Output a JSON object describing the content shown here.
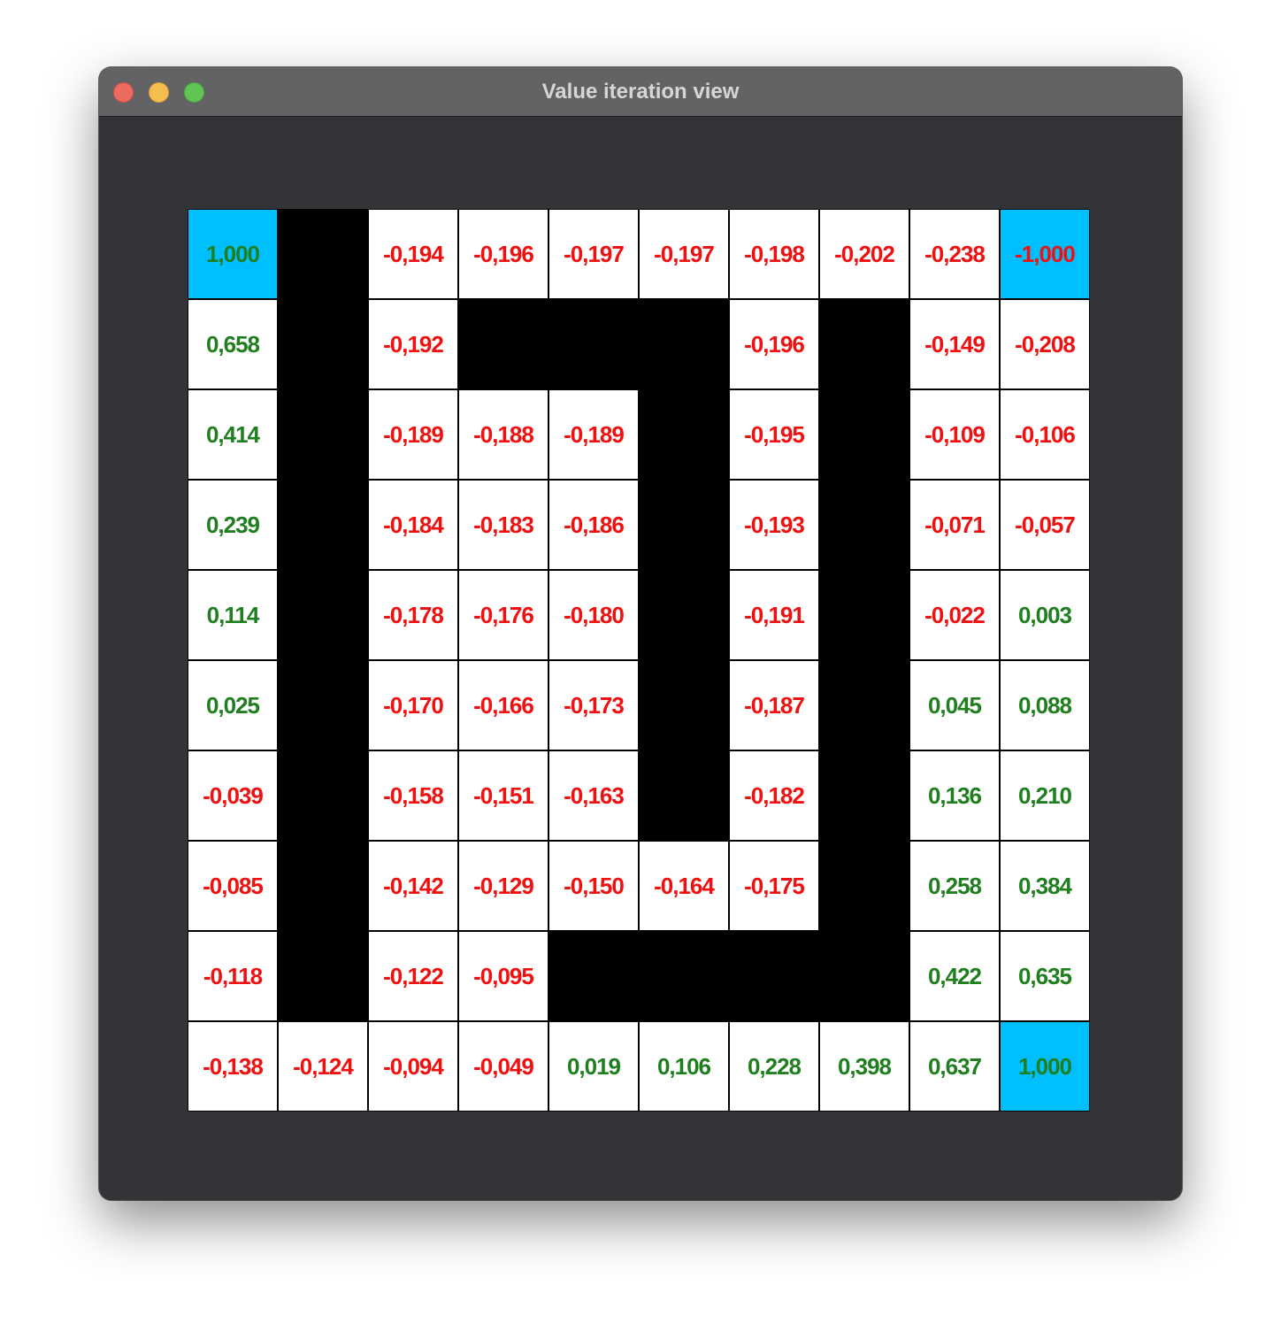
{
  "window": {
    "title": "Value iteration view"
  },
  "colors": {
    "open": "#ffffff",
    "wall": "#000000",
    "terminal": "#00bfff",
    "positive_text": "#1f7f1f",
    "negative_text": "#f01010",
    "window_bg": "#333438",
    "titlebar_bg": "#636265"
  },
  "grid": {
    "cols": 10,
    "rows": [
      [
        {
          "t": "terminal",
          "v": "1,000"
        },
        {
          "t": "wall"
        },
        {
          "t": "open",
          "v": "-0,194"
        },
        {
          "t": "open",
          "v": "-0,196"
        },
        {
          "t": "open",
          "v": "-0,197"
        },
        {
          "t": "open",
          "v": "-0,197"
        },
        {
          "t": "open",
          "v": "-0,198"
        },
        {
          "t": "open",
          "v": "-0,202"
        },
        {
          "t": "open",
          "v": "-0,238"
        },
        {
          "t": "terminal",
          "v": "-1,000"
        }
      ],
      [
        {
          "t": "open",
          "v": "0,658"
        },
        {
          "t": "wall"
        },
        {
          "t": "open",
          "v": "-0,192"
        },
        {
          "t": "wall"
        },
        {
          "t": "wall"
        },
        {
          "t": "wall"
        },
        {
          "t": "open",
          "v": "-0,196"
        },
        {
          "t": "wall"
        },
        {
          "t": "open",
          "v": "-0,149"
        },
        {
          "t": "open",
          "v": "-0,208"
        }
      ],
      [
        {
          "t": "open",
          "v": "0,414"
        },
        {
          "t": "wall"
        },
        {
          "t": "open",
          "v": "-0,189"
        },
        {
          "t": "open",
          "v": "-0,188"
        },
        {
          "t": "open",
          "v": "-0,189"
        },
        {
          "t": "wall"
        },
        {
          "t": "open",
          "v": "-0,195"
        },
        {
          "t": "wall"
        },
        {
          "t": "open",
          "v": "-0,109"
        },
        {
          "t": "open",
          "v": "-0,106"
        }
      ],
      [
        {
          "t": "open",
          "v": "0,239"
        },
        {
          "t": "wall"
        },
        {
          "t": "open",
          "v": "-0,184"
        },
        {
          "t": "open",
          "v": "-0,183"
        },
        {
          "t": "open",
          "v": "-0,186"
        },
        {
          "t": "wall"
        },
        {
          "t": "open",
          "v": "-0,193"
        },
        {
          "t": "wall"
        },
        {
          "t": "open",
          "v": "-0,071"
        },
        {
          "t": "open",
          "v": "-0,057"
        }
      ],
      [
        {
          "t": "open",
          "v": "0,114"
        },
        {
          "t": "wall"
        },
        {
          "t": "open",
          "v": "-0,178"
        },
        {
          "t": "open",
          "v": "-0,176"
        },
        {
          "t": "open",
          "v": "-0,180"
        },
        {
          "t": "wall"
        },
        {
          "t": "open",
          "v": "-0,191"
        },
        {
          "t": "wall"
        },
        {
          "t": "open",
          "v": "-0,022"
        },
        {
          "t": "open",
          "v": "0,003"
        }
      ],
      [
        {
          "t": "open",
          "v": "0,025"
        },
        {
          "t": "wall"
        },
        {
          "t": "open",
          "v": "-0,170"
        },
        {
          "t": "open",
          "v": "-0,166"
        },
        {
          "t": "open",
          "v": "-0,173"
        },
        {
          "t": "wall"
        },
        {
          "t": "open",
          "v": "-0,187"
        },
        {
          "t": "wall"
        },
        {
          "t": "open",
          "v": "0,045"
        },
        {
          "t": "open",
          "v": "0,088"
        }
      ],
      [
        {
          "t": "open",
          "v": "-0,039"
        },
        {
          "t": "wall"
        },
        {
          "t": "open",
          "v": "-0,158"
        },
        {
          "t": "open",
          "v": "-0,151"
        },
        {
          "t": "open",
          "v": "-0,163"
        },
        {
          "t": "wall"
        },
        {
          "t": "open",
          "v": "-0,182"
        },
        {
          "t": "wall"
        },
        {
          "t": "open",
          "v": "0,136"
        },
        {
          "t": "open",
          "v": "0,210"
        }
      ],
      [
        {
          "t": "open",
          "v": "-0,085"
        },
        {
          "t": "wall"
        },
        {
          "t": "open",
          "v": "-0,142"
        },
        {
          "t": "open",
          "v": "-0,129"
        },
        {
          "t": "open",
          "v": "-0,150"
        },
        {
          "t": "open",
          "v": "-0,164"
        },
        {
          "t": "open",
          "v": "-0,175"
        },
        {
          "t": "wall"
        },
        {
          "t": "open",
          "v": "0,258"
        },
        {
          "t": "open",
          "v": "0,384"
        }
      ],
      [
        {
          "t": "open",
          "v": "-0,118"
        },
        {
          "t": "wall"
        },
        {
          "t": "open",
          "v": "-0,122"
        },
        {
          "t": "open",
          "v": "-0,095"
        },
        {
          "t": "wall"
        },
        {
          "t": "wall"
        },
        {
          "t": "wall"
        },
        {
          "t": "wall"
        },
        {
          "t": "open",
          "v": "0,422"
        },
        {
          "t": "open",
          "v": "0,635"
        }
      ],
      [
        {
          "t": "open",
          "v": "-0,138"
        },
        {
          "t": "open",
          "v": "-0,124"
        },
        {
          "t": "open",
          "v": "-0,094"
        },
        {
          "t": "open",
          "v": "-0,049"
        },
        {
          "t": "open",
          "v": "0,019"
        },
        {
          "t": "open",
          "v": "0,106"
        },
        {
          "t": "open",
          "v": "0,228"
        },
        {
          "t": "open",
          "v": "0,398"
        },
        {
          "t": "open",
          "v": "0,637"
        },
        {
          "t": "terminal",
          "v": "1,000"
        }
      ]
    ]
  }
}
